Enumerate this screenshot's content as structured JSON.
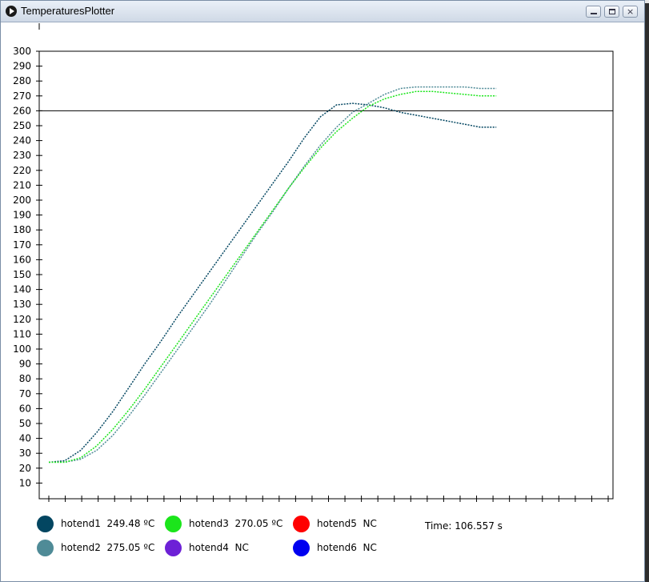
{
  "window": {
    "title": "TemperaturesPlotter",
    "minimize_symbol": "",
    "maximize_symbol": "",
    "close_symbol": "×"
  },
  "colors": {
    "hotend1": "#034661",
    "hotend2": "#4f8b97",
    "hotend3": "#1be51b",
    "hotend4": "#6d21d6",
    "hotend5": "#ff0000",
    "hotend6": "#0000f0",
    "grid_line": "#000000",
    "axes": "#000000"
  },
  "legend": [
    {
      "name": "hotend1",
      "text": "hotend1  249.48 ºC",
      "color_key": "hotend1"
    },
    {
      "name": "hotend2",
      "text": "hotend2  275.05 ºC",
      "color_key": "hotend2"
    },
    {
      "name": "hotend3",
      "text": "hotend3  270.05 ºC",
      "color_key": "hotend3"
    },
    {
      "name": "hotend4",
      "text": "hotend4  NC",
      "color_key": "hotend4"
    },
    {
      "name": "hotend5",
      "text": "hotend5  NC",
      "color_key": "hotend5"
    },
    {
      "name": "hotend6",
      "text": "hotend6  NC",
      "color_key": "hotend6"
    }
  ],
  "time_readout": "Time: 106.557 s",
  "chart_data": {
    "type": "line",
    "title": "",
    "xlabel": "",
    "ylabel": "",
    "ylim": [
      0,
      310
    ],
    "xlim": [
      0,
      140
    ],
    "y_ticks": [
      10,
      20,
      30,
      40,
      50,
      60,
      70,
      80,
      90,
      100,
      110,
      120,
      130,
      140,
      150,
      160,
      170,
      180,
      190,
      200,
      210,
      220,
      230,
      240,
      250,
      260,
      270,
      280,
      290,
      300
    ],
    "x_tick_count": 35,
    "reference_lines": [
      300,
      260
    ],
    "grid": false,
    "legend_position": "bottom",
    "series": [
      {
        "name": "hotend1",
        "color_key": "hotend1",
        "x": [
          0,
          4,
          8,
          12,
          16,
          20,
          24,
          28,
          32,
          36,
          40,
          44,
          48,
          52,
          56,
          60,
          64,
          68,
          72,
          76,
          80,
          84,
          88,
          92,
          96,
          100,
          104,
          108,
          112
        ],
        "y": [
          24,
          25,
          32,
          44,
          58,
          74,
          90,
          105,
          121,
          136,
          151,
          166,
          181,
          196,
          211,
          226,
          242,
          256,
          264,
          265,
          264,
          262,
          259,
          257,
          255,
          253,
          251,
          249,
          249
        ]
      },
      {
        "name": "hotend2",
        "color_key": "hotend2",
        "x": [
          0,
          4,
          8,
          12,
          16,
          20,
          24,
          28,
          32,
          36,
          40,
          44,
          48,
          52,
          56,
          60,
          64,
          68,
          72,
          76,
          80,
          84,
          88,
          92,
          96,
          100,
          104,
          108,
          112
        ],
        "y": [
          24,
          24,
          26,
          32,
          42,
          55,
          69,
          84,
          99,
          114,
          129,
          145,
          161,
          177,
          192,
          208,
          223,
          237,
          249,
          259,
          265,
          271,
          275,
          276,
          276,
          276,
          276,
          275,
          275
        ]
      },
      {
        "name": "hotend3",
        "color_key": "hotend3",
        "x": [
          0,
          4,
          8,
          12,
          16,
          20,
          24,
          28,
          32,
          36,
          40,
          44,
          48,
          52,
          56,
          60,
          64,
          68,
          72,
          76,
          80,
          84,
          88,
          92,
          96,
          100,
          104,
          108,
          112
        ],
        "y": [
          24,
          24,
          27,
          35,
          46,
          59,
          73,
          88,
          103,
          118,
          133,
          148,
          163,
          178,
          193,
          208,
          222,
          235,
          246,
          255,
          263,
          268,
          271,
          273,
          273,
          272,
          271,
          270,
          270
        ]
      }
    ]
  }
}
